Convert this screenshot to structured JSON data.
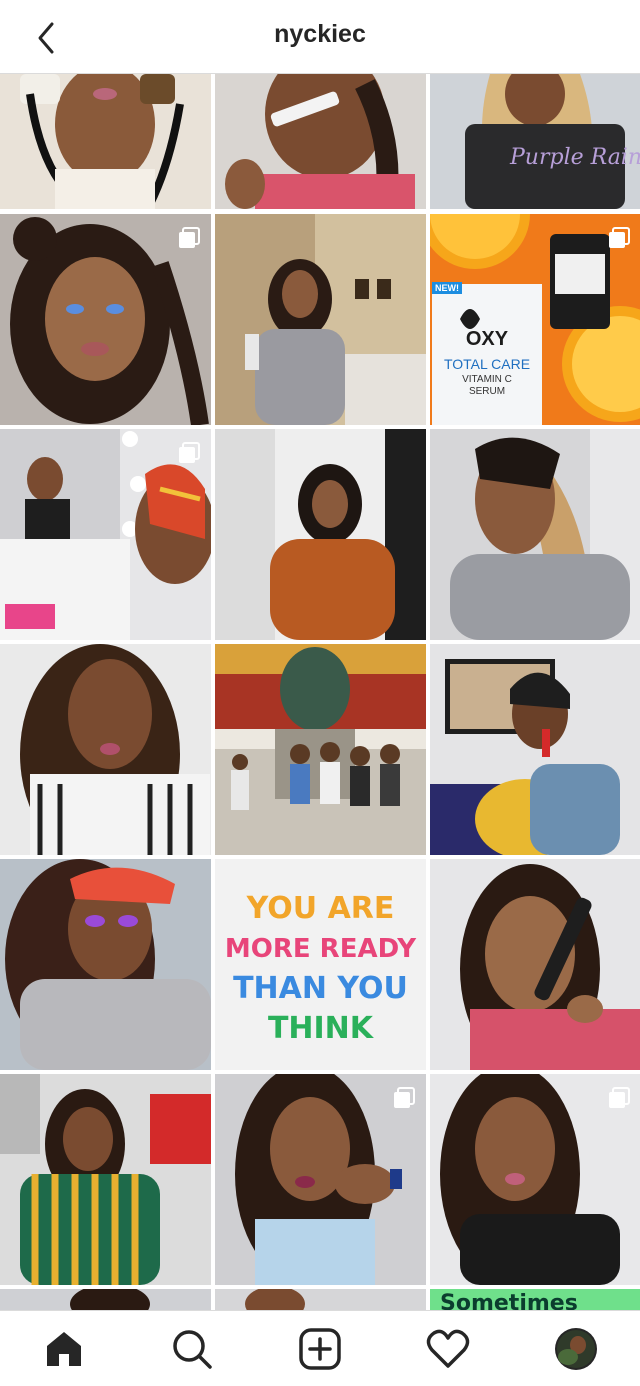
{
  "header": {
    "username": "nyckiec"
  },
  "grid": {
    "quote_lines": [
      "YOU ARE",
      "MORE READY",
      "THAN YOU",
      "THINK"
    ],
    "banner_partial": "Sometimes",
    "product_box": {
      "badge": "NEW!",
      "brand": "OXY",
      "line1": "TOTAL CARE",
      "line2": "VITAMIN C",
      "line3": "SERUM"
    },
    "tile_colors": {
      "orange": "#f07a1a",
      "sweater": "#b85a22",
      "banner": "#6fe08b"
    }
  },
  "tabbar": {
    "icons": [
      "home-icon",
      "search-icon",
      "new-post-icon",
      "activity-heart-icon",
      "profile-avatar"
    ]
  }
}
